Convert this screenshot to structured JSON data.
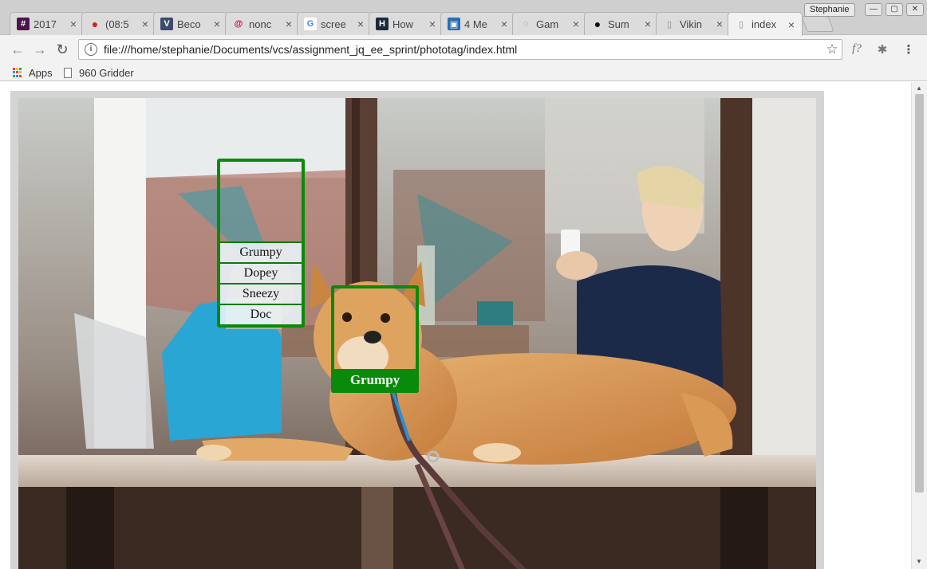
{
  "browser": {
    "profile_name": "Stephanie",
    "window_buttons": {
      "minimize": "—",
      "maximize": "▢",
      "close": "✕"
    },
    "tabs": [
      {
        "title": "2017",
        "icon": "slack-icon",
        "icon_color": "#4a154b",
        "icon_glyph": "#",
        "active": false
      },
      {
        "title": "(08:5",
        "icon": "tomato-icon",
        "icon_color": "#d81f1f",
        "icon_glyph": "●",
        "active": false
      },
      {
        "title": "Beco",
        "icon": "vagrant-icon",
        "icon_color": "#3b4d6b",
        "icon_glyph": "V",
        "active": false
      },
      {
        "title": "nonc",
        "icon": "debian-icon",
        "icon_color": "#c70036",
        "icon_glyph": "@",
        "active": false
      },
      {
        "title": "scree",
        "icon": "google-icon",
        "icon_color": "#ffffff",
        "icon_glyph": "G",
        "active": false
      },
      {
        "title": "How",
        "icon": "htg-icon",
        "icon_color": "#1b2a3a",
        "icon_glyph": "H",
        "active": false
      },
      {
        "title": "4 Me",
        "icon": "frame-icon",
        "icon_color": "#2a6db4",
        "icon_glyph": "▣",
        "active": false
      },
      {
        "title": "Gam",
        "icon": "loading-icon",
        "icon_color": "#4caf50",
        "icon_glyph": "◌",
        "active": false
      },
      {
        "title": "Sum",
        "icon": "grenade-icon",
        "icon_color": "#111111",
        "icon_glyph": "●",
        "active": false
      },
      {
        "title": "Vikin",
        "icon": "page-icon",
        "icon_color": "#888888",
        "icon_glyph": "▯",
        "active": false
      },
      {
        "title": "index",
        "icon": "page-icon",
        "icon_color": "#888888",
        "icon_glyph": "▯",
        "active": true
      }
    ],
    "tab_close_glyph": "×",
    "nav": {
      "back": "←",
      "forward": "→",
      "reload": "↻"
    },
    "omnibox": {
      "info_glyph": "i",
      "url": "file:///home/stephanie/Documents/vcs/assignment_jq_ee_sprint/phototag/index.html",
      "star_glyph": "☆"
    },
    "extensions": [
      {
        "name": "font-finder-icon",
        "glyph": "f?"
      },
      {
        "name": "bug-icon",
        "glyph": "✱"
      },
      {
        "name": "menu-icon",
        "glyph": "⋮"
      }
    ],
    "bookmarks": [
      {
        "label": "Apps",
        "icon": "apps-grid-icon"
      },
      {
        "label": "960 Gridder",
        "icon": "page-icon"
      }
    ]
  },
  "page": {
    "photo_description_hidden": false,
    "tag_selector": {
      "names": [
        "Grumpy",
        "Dopey",
        "Sneezy",
        "Doc"
      ],
      "border_color": "#0a8a0a"
    },
    "tagged": {
      "label": "Grumpy",
      "border_color": "#0a8a0a"
    }
  }
}
